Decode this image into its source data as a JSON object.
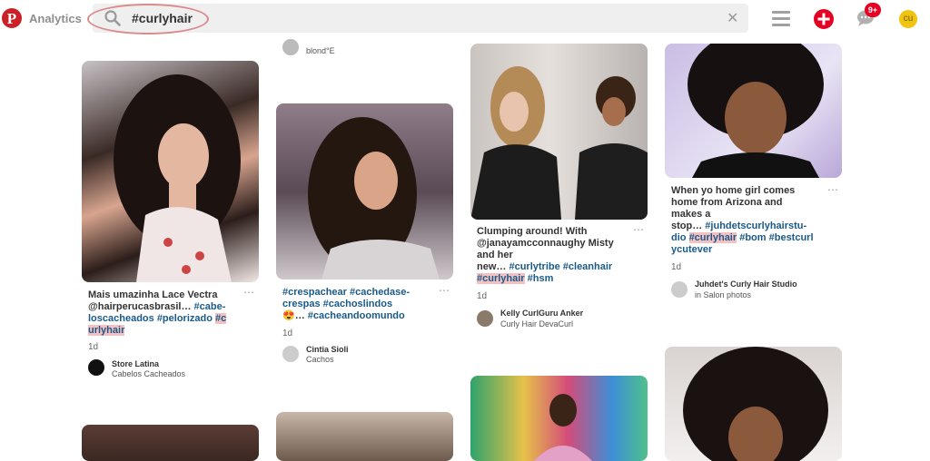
{
  "header": {
    "app_label": "Analytics",
    "search_value": "#curlyhair",
    "notification_count": "9+",
    "user_initials": "cu"
  },
  "pins": {
    "top_partial": {
      "author_sub": "blond°E"
    },
    "pin1": {
      "desc_text": "Mais umazinha Lace Vectra @hairperucasbrasil…",
      "tags": "#cabe- loscacheados #pelorizado",
      "hl_tag": "#c urlyhair",
      "time": "1d",
      "author_name": "Store Latina",
      "author_sub": "Cabelos Cacheados"
    },
    "pin2": {
      "tags_line1": "#crespachear #cachedase-",
      "tags_line2": "crespas #cachoslindos",
      "tags_line3": "#cacheandoomundo",
      "emoji": "😍…",
      "time": "1d",
      "author_name": "Cintia Sioli",
      "author_sub": "Cachos"
    },
    "pin3": {
      "desc_line1": "Clumping around! With",
      "desc_line2": "@janayamcconnaughy Misty",
      "desc_line3": "and her",
      "desc_line4": "new…",
      "tags": "#curlytribe #cleanhair",
      "hl_tag": "#curlyhair",
      "tag_after": "#hsm",
      "time": "1d",
      "author_name": "Kelly CurlGuru Anker",
      "author_sub": "Curly Hair DevaCurl"
    },
    "pin4": {
      "desc_line1": "When yo home girl comes",
      "desc_line2": "home from Arizona and",
      "desc_line3": "makes a",
      "desc_line4": "stop…",
      "tags_line1": "#juhdetscurlyhairstu-",
      "tags_line2_pre": "dio",
      "hl_tag": "#curlyhair",
      "tags_line2_post": "#bom #bestcurl",
      "tags_line3": "ycutever",
      "time": "1d",
      "author_name": "Juhdet's Curly Hair Studio",
      "author_sub": "in Salon photos"
    }
  },
  "colors": {
    "brand": "#cb2027",
    "tag": "#1a5a8a",
    "highlight": "#f3c1c1"
  }
}
